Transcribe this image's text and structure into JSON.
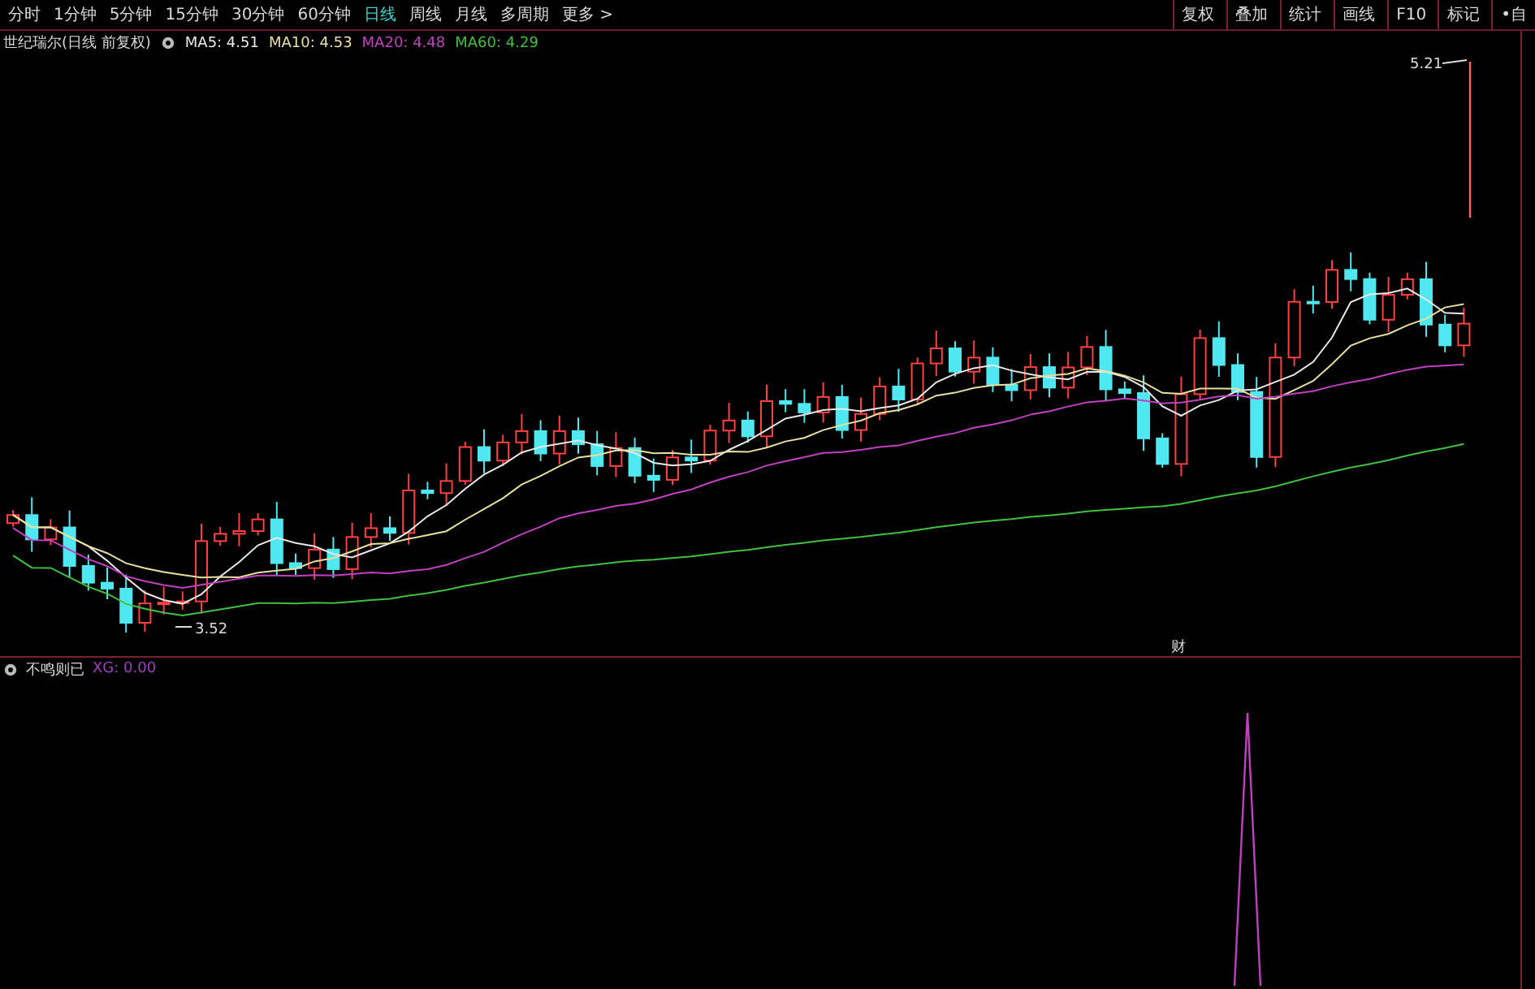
{
  "toolbar": {
    "periods": [
      {
        "label": "分时",
        "selected": false
      },
      {
        "label": "1分钟",
        "selected": false
      },
      {
        "label": "5分钟",
        "selected": false
      },
      {
        "label": "15分钟",
        "selected": false
      },
      {
        "label": "30分钟",
        "selected": false
      },
      {
        "label": "60分钟",
        "selected": false
      },
      {
        "label": "日线",
        "selected": true
      },
      {
        "label": "周线",
        "selected": false
      },
      {
        "label": "月线",
        "selected": false
      },
      {
        "label": "多周期",
        "selected": false
      },
      {
        "label": "更多 >",
        "selected": false
      }
    ],
    "actions": [
      "复权",
      "叠加",
      "统计",
      "画线",
      "F10",
      "标记",
      "•自"
    ]
  },
  "legend": {
    "title": "世纪瑞尔(日线 前复权)",
    "averages": [
      {
        "label": "MA5: 4.51",
        "color": "#e8e8e8"
      },
      {
        "label": "MA10: 4.53",
        "color": "#e8e0a0"
      },
      {
        "label": "MA20: 4.48",
        "color": "#c040c0"
      },
      {
        "label": "MA60: 4.29",
        "color": "#40c040"
      }
    ]
  },
  "main_chart": {
    "high_label": "5.21",
    "low_label": "3.52",
    "event_marker": "财"
  },
  "indicator": {
    "name": "不鸣则已",
    "reading": "XG: 0.00"
  }
}
